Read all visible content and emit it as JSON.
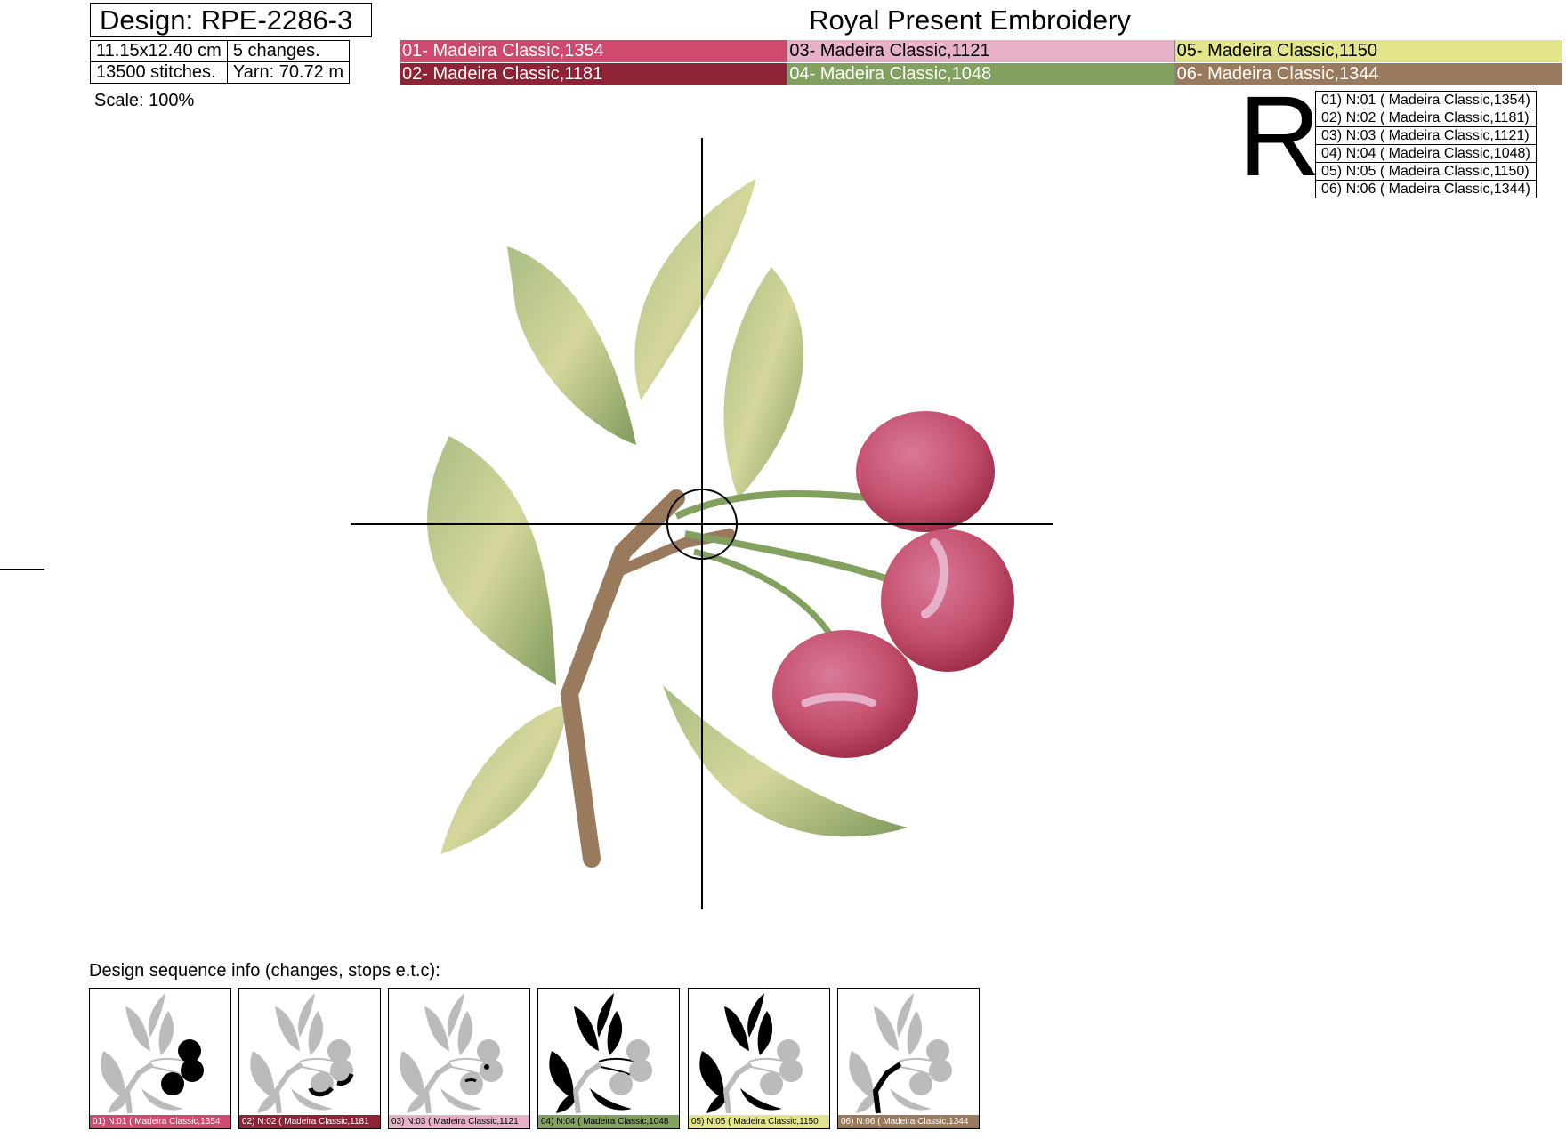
{
  "header": {
    "design_label": "Design: RPE-2286-3",
    "brand": "Royal Present Embroidery"
  },
  "specs": {
    "size": "11.15x12.40 cm",
    "changes": "5 changes.",
    "stitches": "13500 stitches.",
    "yarn": "Yarn: 70.72 m"
  },
  "colors": [
    {
      "label": "01- Madeira Classic,1354",
      "hex": "#cf4a6e",
      "text": "#ffffff"
    },
    {
      "label": "03- Madeira Classic,1121",
      "hex": "#e6b1c8",
      "text": "#000000"
    },
    {
      "label": "05- Madeira Classic,1150",
      "hex": "#e3e58a",
      "text": "#000000"
    },
    {
      "label": "02- Madeira Classic,1181",
      "hex": "#8e2336",
      "text": "#ffffff"
    },
    {
      "label": "04- Madeira Classic,1048",
      "hex": "#82a05e",
      "text": "#ffffff"
    },
    {
      "label": "06- Madeira Classic,1344",
      "hex": "#9a7a5c",
      "text": "#ffffff"
    }
  ],
  "scale": "Scale: 100%",
  "orientation_mark": "R",
  "needles": [
    "01) N:01 ( Madeira Classic,1354)",
    "02) N:02 ( Madeira Classic,1181)",
    "03) N:03 ( Madeira Classic,1121)",
    "04) N:04 ( Madeira Classic,1048)",
    "05) N:05 ( Madeira Classic,1150)",
    "06) N:06 ( Madeira Classic,1344)"
  ],
  "sequence": {
    "label": "Design sequence info (changes, stops e.t.c):",
    "steps": [
      {
        "caption": "01) N:01 ( Madeira Classic,1354",
        "hex": "#cf4a6e",
        "text": "#ffffff",
        "highlight": "cherries"
      },
      {
        "caption": "02) N:02 ( Madeira Classic,1181",
        "hex": "#8e2336",
        "text": "#ffffff",
        "highlight": "shadows"
      },
      {
        "caption": "03) N:03 ( Madeira Classic,1121",
        "hex": "#e6b1c8",
        "text": "#000000",
        "highlight": "highlights"
      },
      {
        "caption": "04) N:04 ( Madeira Classic,1048",
        "hex": "#82a05e",
        "text": "#000000",
        "highlight": "leaves"
      },
      {
        "caption": "05) N:05 ( Madeira Classic,1150",
        "hex": "#e3e58a",
        "text": "#000000",
        "highlight": "leaf-light"
      },
      {
        "caption": "06) N:06 ( Madeira Classic,1344",
        "hex": "#9a7a5c",
        "text": "#ffffff",
        "highlight": "branch"
      }
    ]
  }
}
